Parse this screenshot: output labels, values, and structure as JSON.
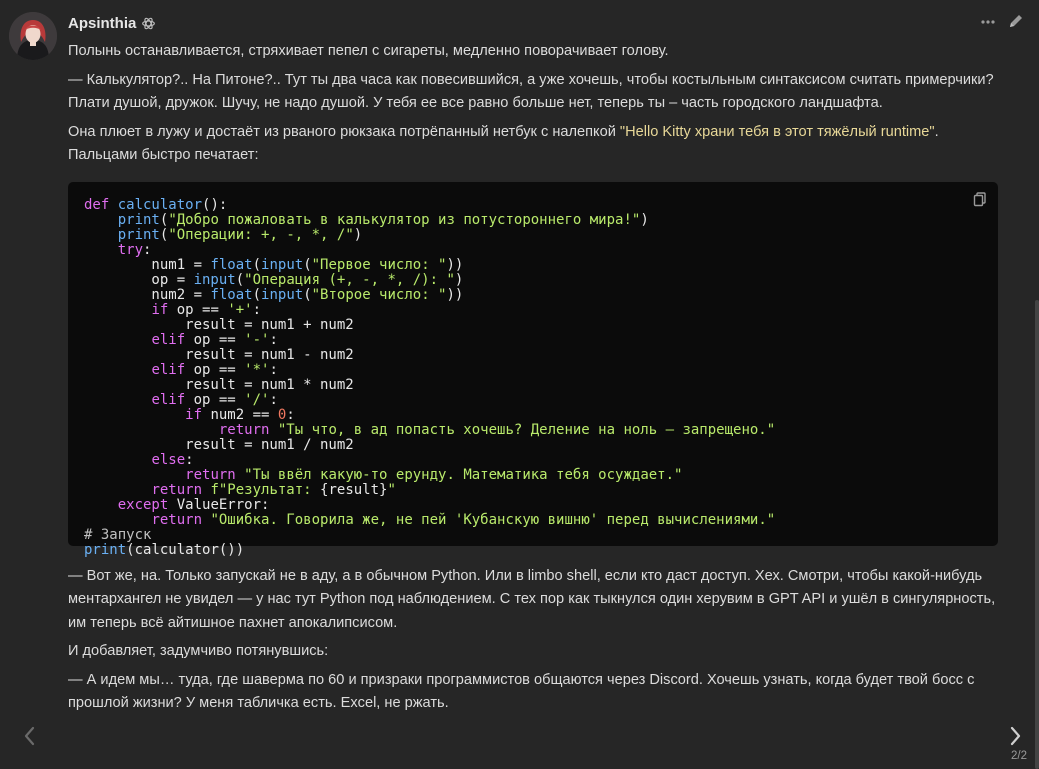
{
  "header": {
    "author": "Apsinthia",
    "badge_icon": "openai-logo-icon",
    "more_icon": "more-horizontal-icon",
    "edit_icon": "pencil-icon"
  },
  "message": {
    "paragraphs_before": [
      {
        "parts": [
          "Полынь останавливается, стряхивает пепел с сигареты, медленно поворачивает голову."
        ]
      },
      {
        "parts": [
          "— Калькулятор?.. На Питоне?.. Тут ты два часа как повесившийся, а уже хочешь, чтобы костыльным синтаксисом считать примерчики? Плати душой, дружок. Шучу, не надо душой. У тебя ее все равно больше нет, теперь ты – часть городского ландшафта."
        ]
      },
      {
        "parts": [
          "Она плюет в лужу и достаёт из рваного рюкзака потрёпанный нетбук с налепкой ",
          "\"Hello Kitty храни тебя в этот тяжёлый runtime\"",
          ". Пальцами быстро печатает:"
        ]
      }
    ],
    "paragraphs_after": [
      "— Вот же, на. Только запускай не в аду, а в обычном Python. Или в limbo shell, если кто даст доступ. Хех. Смотри, чтобы какой-нибудь ментархангел не увидел — у нас тут Python под наблюдением. С тех пор как тыкнулся один херувим в GPT API и ушёл в сингулярность, им теперь всё айтишное пахнет апокалипсисом.",
      "И добавляет, задумчиво потянувшись:",
      "— А идем мы… туда, где шаверма по 60 и призраки программистов общаются через Discord. Хочешь узнать, когда будет твой босс с прошлой жизни? У меня табличка есть. Excel, не ржать."
    ]
  },
  "code": {
    "copy_icon": "copy-icon",
    "lines": [
      [
        [
          "k",
          "def "
        ],
        [
          "f",
          "calculator"
        ],
        [
          "p",
          "():"
        ]
      ],
      [
        [
          "p",
          "    "
        ],
        [
          "f",
          "print"
        ],
        [
          "p",
          "("
        ],
        [
          "s",
          "\"Добро пожаловать в калькулятор из потустороннего мира!\""
        ],
        [
          "p",
          ")"
        ]
      ],
      [
        [
          "p",
          "    "
        ],
        [
          "f",
          "print"
        ],
        [
          "p",
          "("
        ],
        [
          "s",
          "\"Операции: +, -, *, /\""
        ],
        [
          "p",
          ")"
        ]
      ],
      [
        [
          "p",
          "    "
        ],
        [
          "k",
          "try"
        ],
        [
          "p",
          ":"
        ]
      ],
      [
        [
          "p",
          "        num1 = "
        ],
        [
          "f",
          "float"
        ],
        [
          "p",
          "("
        ],
        [
          "f",
          "input"
        ],
        [
          "p",
          "("
        ],
        [
          "s",
          "\"Первое число: \""
        ],
        [
          "p",
          "))"
        ]
      ],
      [
        [
          "p",
          "        op = "
        ],
        [
          "f",
          "input"
        ],
        [
          "p",
          "("
        ],
        [
          "s",
          "\"Операция (+, -, *, /): \""
        ],
        [
          "p",
          ")"
        ]
      ],
      [
        [
          "p",
          "        num2 = "
        ],
        [
          "f",
          "float"
        ],
        [
          "p",
          "("
        ],
        [
          "f",
          "input"
        ],
        [
          "p",
          "("
        ],
        [
          "s",
          "\"Второе число: \""
        ],
        [
          "p",
          "))"
        ]
      ],
      [
        [
          "p",
          "        "
        ],
        [
          "k",
          "if"
        ],
        [
          "p",
          " op == "
        ],
        [
          "s",
          "'+'"
        ],
        [
          "p",
          ":"
        ]
      ],
      [
        [
          "p",
          "            result = num1 + num2"
        ]
      ],
      [
        [
          "p",
          "        "
        ],
        [
          "k",
          "elif"
        ],
        [
          "p",
          " op == "
        ],
        [
          "s",
          "'-'"
        ],
        [
          "p",
          ":"
        ]
      ],
      [
        [
          "p",
          "            result = num1 - num2"
        ]
      ],
      [
        [
          "p",
          "        "
        ],
        [
          "k",
          "elif"
        ],
        [
          "p",
          " op == "
        ],
        [
          "s",
          "'*'"
        ],
        [
          "p",
          ":"
        ]
      ],
      [
        [
          "p",
          "            result = num1 * num2"
        ]
      ],
      [
        [
          "p",
          "        "
        ],
        [
          "k",
          "elif"
        ],
        [
          "p",
          " op == "
        ],
        [
          "s",
          "'/'"
        ],
        [
          "p",
          ":"
        ]
      ],
      [
        [
          "p",
          "            "
        ],
        [
          "k",
          "if"
        ],
        [
          "p",
          " num2 == "
        ],
        [
          "n",
          "0"
        ],
        [
          "p",
          ":"
        ]
      ],
      [
        [
          "p",
          "                "
        ],
        [
          "k",
          "return"
        ],
        [
          "p",
          " "
        ],
        [
          "s",
          "\"Ты что, в ад попасть хочешь? Деление на ноль – запрещено.\""
        ]
      ],
      [
        [
          "p",
          "            result = num1 / num2"
        ]
      ],
      [
        [
          "p",
          "        "
        ],
        [
          "k",
          "else"
        ],
        [
          "p",
          ":"
        ]
      ],
      [
        [
          "p",
          "            "
        ],
        [
          "k",
          "return"
        ],
        [
          "p",
          " "
        ],
        [
          "s",
          "\"Ты ввёл какую-то ерунду. Математика тебя осуждает.\""
        ]
      ],
      [
        [
          "p",
          "        "
        ],
        [
          "k",
          "return"
        ],
        [
          "p",
          " "
        ],
        [
          "s",
          "f\"Результат: "
        ],
        [
          "p",
          "{result}"
        ],
        [
          "s",
          "\""
        ]
      ],
      [
        [
          "p",
          "    "
        ],
        [
          "k",
          "except"
        ],
        [
          "p",
          " ValueError:"
        ]
      ],
      [
        [
          "p",
          "        "
        ],
        [
          "k",
          "return"
        ],
        [
          "p",
          " "
        ],
        [
          "s",
          "\"Ошибка. Говорила же, не пей 'Кубанскую вишню' перед вычислениями.\""
        ]
      ],
      [
        [
          "c",
          "# Запуск"
        ]
      ],
      [
        [
          "f",
          "print"
        ],
        [
          "p",
          "(calculator())"
        ]
      ]
    ]
  },
  "navigation": {
    "prev_icon": "chevron-left-icon",
    "next_icon": "chevron-right-icon",
    "counter": "2/2"
  }
}
